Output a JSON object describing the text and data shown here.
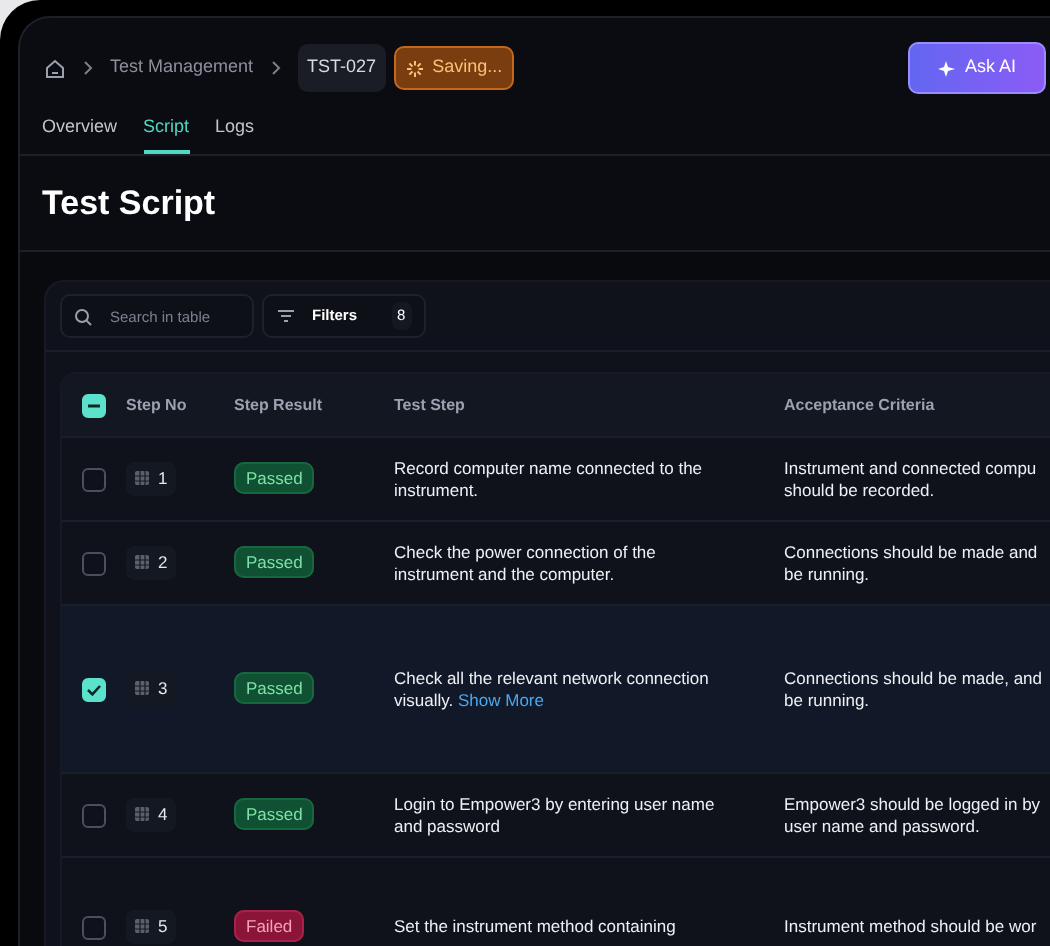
{
  "breadcrumb": [
    {
      "label": "Test Management"
    }
  ],
  "record_id": "TST-027",
  "status_badge": {
    "label": "Saving...",
    "kind": "saving"
  },
  "ask_ai": "Ask AI",
  "tabs": [
    {
      "label": "Overview",
      "selected": false
    },
    {
      "label": "Script",
      "selected": true
    },
    {
      "label": "Logs",
      "selected": false
    }
  ],
  "title": "Test Script",
  "search": {
    "placeholder": "Search in table"
  },
  "filters": {
    "label": "Filters",
    "count": "8"
  },
  "header_checkbox": {
    "indeterminate": true
  },
  "columns": [
    "Step No",
    "Step Result",
    "Test Step",
    "Acceptance Criteria"
  ],
  "rows": [
    {
      "checked": false,
      "selected": false,
      "step_no": "1",
      "result": {
        "label": "Passed",
        "kind": "passed"
      },
      "test_step": [
        "Record computer name connected to the",
        "instrument."
      ],
      "acceptance": [
        "Instrument and connected compu",
        "should be recorded."
      ]
    },
    {
      "checked": false,
      "selected": false,
      "step_no": "2",
      "result": {
        "label": "Passed",
        "kind": "passed"
      },
      "test_step": [
        "Check the power connection of the",
        "instrument and the computer."
      ],
      "acceptance": [
        "Connections should be made and",
        "be running."
      ]
    },
    {
      "checked": true,
      "selected": true,
      "step_no": "3",
      "result": {
        "label": "Passed",
        "kind": "passed"
      },
      "test_step": [
        "Check all the relevant network connection",
        "visually."
      ],
      "link": "Show More",
      "acceptance": [
        "Connections should be made, and",
        "be running."
      ]
    },
    {
      "checked": false,
      "selected": false,
      "step_no": "4",
      "result": {
        "label": "Passed",
        "kind": "passed"
      },
      "test_step": [
        "Login to Empower3 by entering user name",
        "and password"
      ],
      "acceptance": [
        "Empower3 should be logged in by",
        "user name and password."
      ]
    },
    {
      "checked": false,
      "selected": false,
      "step_no": "5",
      "result": {
        "label": "Failed",
        "kind": "failed"
      },
      "test_step": [
        "Set the instrument method containing"
      ],
      "acceptance": [
        "Instrument method should be wor"
      ]
    }
  ]
}
